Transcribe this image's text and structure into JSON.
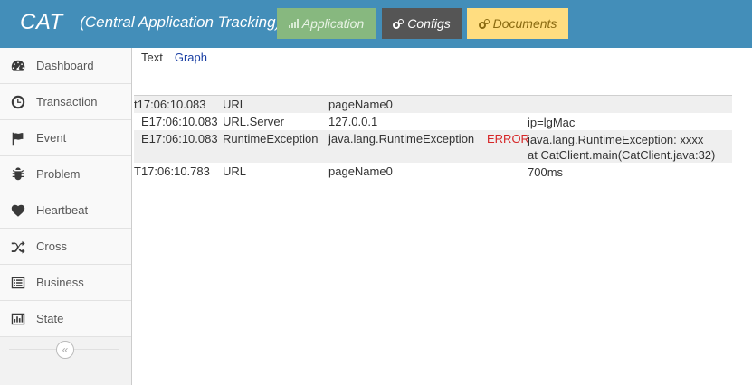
{
  "header": {
    "brand": "CAT",
    "subtitle": "(Central Application Tracking)",
    "buttons": {
      "application": "Application",
      "configs": "Configs",
      "documents": "Documents"
    },
    "colors": {
      "bar": "#438eb9",
      "application": "#87b87f",
      "configs": "#555555",
      "documents": "#ffdd80"
    }
  },
  "sidebar": {
    "items": [
      {
        "label": "Dashboard",
        "icon": "dashboard-icon"
      },
      {
        "label": "Transaction",
        "icon": "clock-icon"
      },
      {
        "label": "Event",
        "icon": "flag-icon"
      },
      {
        "label": "Problem",
        "icon": "bug-icon"
      },
      {
        "label": "Heartbeat",
        "icon": "heart-icon"
      },
      {
        "label": "Cross",
        "icon": "shuffle-icon"
      },
      {
        "label": "Business",
        "icon": "list-icon"
      },
      {
        "label": "State",
        "icon": "bar-chart-icon"
      }
    ],
    "collapse_glyph": "«"
  },
  "tabs": {
    "text": "Text",
    "graph": "Graph"
  },
  "log": {
    "rows": [
      {
        "time": "t17:06:10.083",
        "type": "URL",
        "name": "pageName0",
        "status": "",
        "data": [
          ""
        ]
      },
      {
        "time": "E17:06:10.083",
        "type": "URL.Server",
        "name": "127.0.0.1",
        "status": "",
        "data": [
          "ip=lgMac"
        ]
      },
      {
        "time": "E17:06:10.083",
        "type": "RuntimeException",
        "name": "java.lang.RuntimeException",
        "status": "ERROR",
        "data": [
          "java.lang.RuntimeException: xxxx",
          "at CatClient.main(CatClient.java:32)"
        ]
      },
      {
        "time": "T17:06:10.783",
        "type": "URL",
        "name": "pageName0",
        "status": "",
        "data": [
          "700ms"
        ]
      }
    ],
    "error_color": "#d62728"
  }
}
